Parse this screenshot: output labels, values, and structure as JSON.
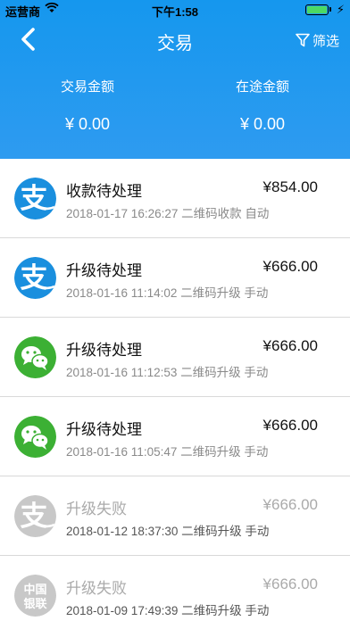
{
  "status_bar": {
    "carrier": "运营商",
    "time": "下午1:58"
  },
  "nav": {
    "title": "交易",
    "filter_label": "筛选"
  },
  "stats": [
    {
      "label": "交易金额",
      "value": "¥ 0.00"
    },
    {
      "label": "在途金额",
      "value": "¥ 0.00"
    }
  ],
  "transactions": [
    {
      "icon": "alipay",
      "title": "收款待处理",
      "amount": "¥854.00",
      "detail": "2018-01-17 16:26:27  二维码收款 自动",
      "dim": false
    },
    {
      "icon": "alipay",
      "title": "升级待处理",
      "amount": "¥666.00",
      "detail": "2018-01-16 11:14:02  二维码升级 手动",
      "dim": false
    },
    {
      "icon": "wechat",
      "title": "升级待处理",
      "amount": "¥666.00",
      "detail": "2018-01-16 11:12:53  二维码升级 手动",
      "dim": false
    },
    {
      "icon": "wechat",
      "title": "升级待处理",
      "amount": "¥666.00",
      "detail": "2018-01-16 11:05:47  二维码升级 手动",
      "dim": false
    },
    {
      "icon": "alipay",
      "title": "升级失败",
      "amount": "¥666.00",
      "detail": "2018-01-12 18:37:30  二维码升级 手动",
      "dim": true
    },
    {
      "icon": "unionpay",
      "title": "升级失败",
      "amount": "¥666.00",
      "detail": "2018-01-09 17:49:39  二维码升级 手动",
      "dim": true
    }
  ],
  "colors": {
    "header": "#1597ee",
    "alipay": "#1a8fde",
    "wechat": "#3cb034",
    "disabled": "#c8c8c8"
  }
}
